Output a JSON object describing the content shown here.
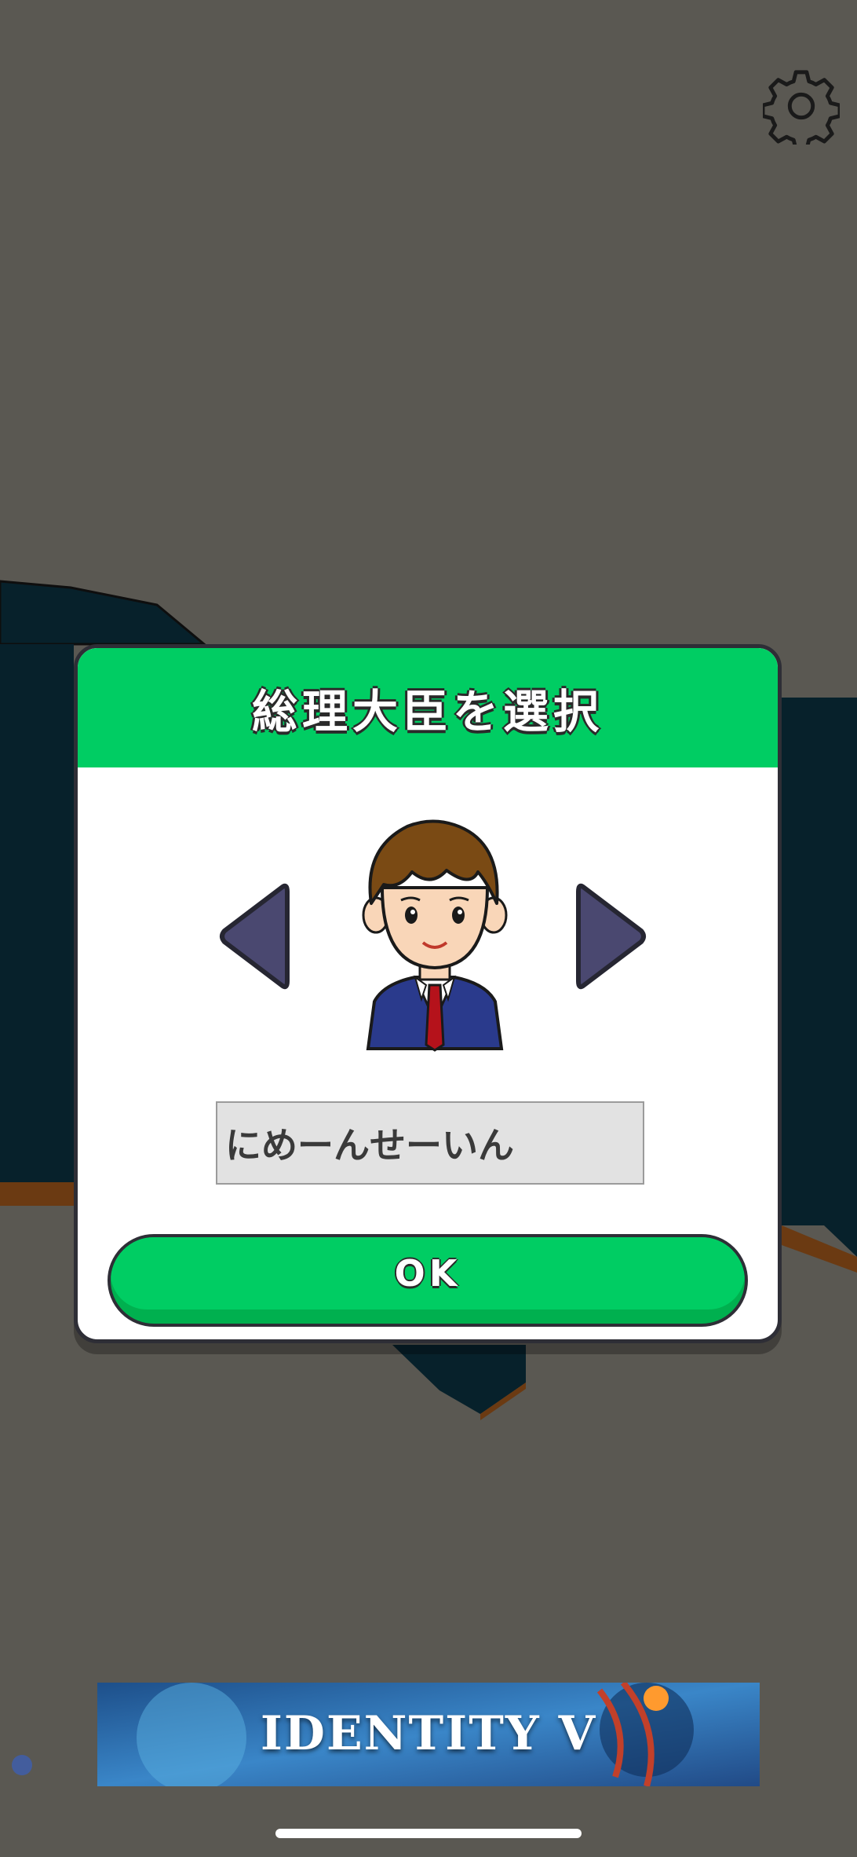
{
  "dialog": {
    "title": "総理大臣を選択",
    "name_value": "にめーんせーいん",
    "ok_label": "OK"
  },
  "ad": {
    "text": "IDENTITY V"
  },
  "icons": {
    "settings": "gear-icon",
    "prev": "triangle-left-icon",
    "next": "triangle-right-icon"
  },
  "colors": {
    "accent_green": "#00cd63",
    "arrow_purple": "#4a4870",
    "background": "#5a5852"
  }
}
